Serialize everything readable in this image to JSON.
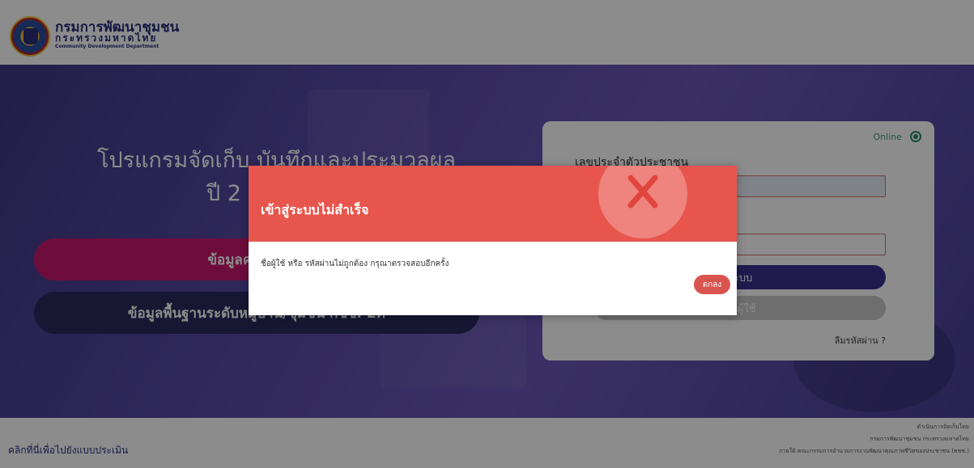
{
  "header": {
    "org_name_th": "กรมการพัฒนาชุมชน",
    "ministry_th": "กระทรวงมหาดไทย",
    "org_name_en": "Community Development Department"
  },
  "hero": {
    "title_line1": "โปรแกรมจัดเก็บ บันทึกและประมวลผล",
    "title_line2": "ปี 2",
    "button_basic_needs": "ข้อมูลความจำเป็",
    "button_village_data": "ข้อมูลพื้นฐานระดับหมู่บ้าน/ชุมชน กชช. 2ค"
  },
  "login": {
    "status_label": "Online",
    "id_label": "เลขประจำตัวประชาชน",
    "login_button": "ระบบ",
    "register_button": "ยนผู้ใช้",
    "forgot_password": "ลืมรหัสผ่าน ?"
  },
  "modal": {
    "title": "เข้าสู่ระบบไม่สำเร็จ",
    "message": "ชื่อผู้ใช้ หรือ รหัสผ่านไม่ถูกต้อง กรุณาตรวจสอบอีกครั้ง",
    "ok_button": "ตกลง"
  },
  "footer": {
    "assessment_link": "คลิกที่นี่เพื่อไปยังแบบประเมิน",
    "credit_line1": "ดำเนินการจัดเก็บโดย",
    "credit_line2": "กรมการพัฒนาชุมชน กระทรวงมหาดไทย",
    "credit_line3": "ภายใต้ คณะกรรมการอำนวยการงานพัฒนาคุณภาพชีวิตของประชาชน (พชช.)"
  },
  "colors": {
    "accent_pink": "#c8196e",
    "accent_navy": "#2b2f7a",
    "error_red": "#e8554c",
    "online_green": "#2e8b64"
  }
}
